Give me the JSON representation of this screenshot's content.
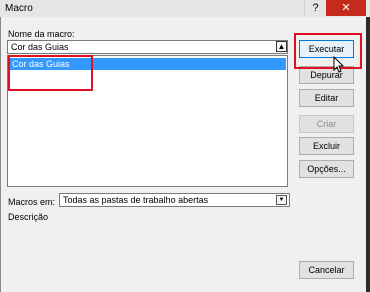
{
  "window": {
    "title": "Macro",
    "help_glyph": "?",
    "close_glyph": "✕"
  },
  "form": {
    "macro_name_label": "Nome da macro:",
    "macro_name_value": "Cor das Guias",
    "list_items": [
      "Cor das Guias"
    ],
    "macros_in_label": "Macros em:",
    "macros_in_value": "Todas as pastas de trabalho abertas",
    "description_label": "Descrição"
  },
  "buttons": {
    "run": "Executar",
    "step_into": "Depurar",
    "edit": "Editar",
    "create": "Criar",
    "delete": "Excluir",
    "options": "Opções...",
    "cancel": "Cancelar"
  },
  "colors": {
    "selection": "#3399ff",
    "close_button": "#c42b1c",
    "highlight_box": "#e01020",
    "primary_border": "#0078d7"
  }
}
